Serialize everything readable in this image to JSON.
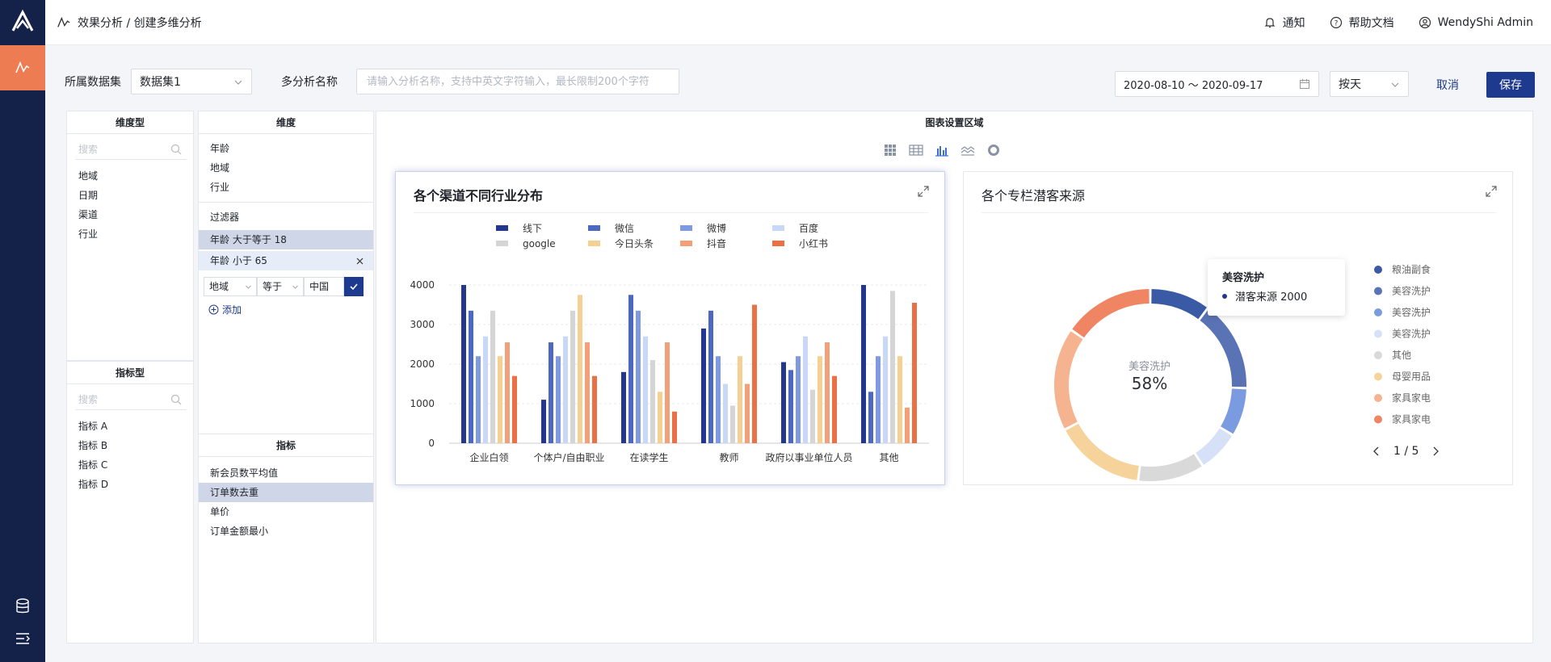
{
  "topbar": {
    "breadcrumb": "效果分析 / 创建多维分析",
    "notice": "通知",
    "help": "帮助文档",
    "user": "WendyShi Admin"
  },
  "controls": {
    "dataset_label": "所属数据集",
    "dataset_value": "数据集1",
    "name_label": "多分析名称",
    "name_placeholder": "请输入分析名称，支持中英文字符输入，最长限制200个字符",
    "date_range": "2020-08-10 ～ 2020-09-17",
    "granularity": "按天",
    "cancel": "取消",
    "save": "保存"
  },
  "dim_panel": {
    "title": "维度型",
    "search_placeholder": "搜索",
    "items": [
      "地域",
      "日期",
      "渠道",
      "行业"
    ]
  },
  "metric_panel": {
    "title": "指标型",
    "search_placeholder": "搜索",
    "items": [
      "指标 A",
      "指标 B",
      "指标 C",
      "指标 D"
    ]
  },
  "middle": {
    "dimension_title": "维度",
    "dimensions": [
      "年龄",
      "地域",
      "行业"
    ],
    "filter_title": "过滤器",
    "filters": [
      "年龄 大于等于 18",
      "年龄 小于 65"
    ],
    "filter_edit": {
      "field": "地域",
      "op": "等于",
      "value": "中国"
    },
    "add": "添加",
    "metric_title": "指标",
    "metrics": [
      "新会员数平均值",
      "订单数去重",
      "单价",
      "订单金额最小"
    ]
  },
  "chart_area_title": "图表设置区域",
  "toolbar_icons": [
    "grid-icon",
    "table-icon",
    "bar-chart-icon",
    "area-chart-icon",
    "donut-chart-icon"
  ],
  "bar_card": {
    "title": "各个渠道不同行业分布"
  },
  "donut_card": {
    "title": "各个专栏潜客来源",
    "center_label": "美容洗护",
    "center_value": "58%",
    "tooltip_title": "美容洗护",
    "tooltip_line": "潜客来源 2000",
    "pager": "1 / 5"
  },
  "chart_data": [
    {
      "type": "bar",
      "categories": [
        "企业白领",
        "个体户/自由职业",
        "在读学生",
        "教师",
        "政府以事业单位人员",
        "其他"
      ],
      "ylim": [
        0,
        4000
      ],
      "yticks": [
        "0",
        "1000",
        "2000",
        "3000",
        "4000"
      ],
      "legend_position": "top",
      "series": [
        {
          "name": "线下",
          "color": "#23378f",
          "values": [
            4000,
            1100,
            1800,
            2900,
            2050,
            4000
          ]
        },
        {
          "name": "微信",
          "color": "#4c68c0",
          "values": [
            3350,
            2550,
            3750,
            3350,
            1850,
            1300
          ]
        },
        {
          "name": "微博",
          "color": "#7f9ae0",
          "values": [
            2200,
            2200,
            3350,
            2200,
            2200,
            2200
          ]
        },
        {
          "name": "百度",
          "color": "#c9d8f6",
          "values": [
            2700,
            2700,
            2700,
            1500,
            2700,
            2700
          ]
        },
        {
          "name": "google",
          "color": "#d5d5d5",
          "values": [
            3350,
            3350,
            2100,
            950,
            1350,
            3850
          ]
        },
        {
          "name": "今日头条",
          "color": "#f6cf93",
          "values": [
            2200,
            3750,
            1300,
            2200,
            2200,
            2200
          ]
        },
        {
          "name": "抖音",
          "color": "#f2a07a",
          "values": [
            2550,
            2550,
            2550,
            1500,
            2550,
            900
          ]
        },
        {
          "name": "小红书",
          "color": "#ea7045",
          "values": [
            1700,
            1700,
            800,
            3500,
            1700,
            3550
          ]
        }
      ]
    },
    {
      "type": "pie",
      "labels": [
        "粮油副食",
        "美容洗护",
        "美容洗护",
        "美容洗护",
        "其他",
        "母婴用品",
        "家具家电",
        "家具家电"
      ],
      "colors": [
        "#3b5aa6",
        "#5a73b5",
        "#7b9be0",
        "#d6e1f7",
        "#d9d9d9",
        "#f6d39a",
        "#f5b48f",
        "#ef8563"
      ],
      "values": [
        10,
        15,
        8,
        7,
        11,
        15,
        17,
        15
      ]
    }
  ]
}
